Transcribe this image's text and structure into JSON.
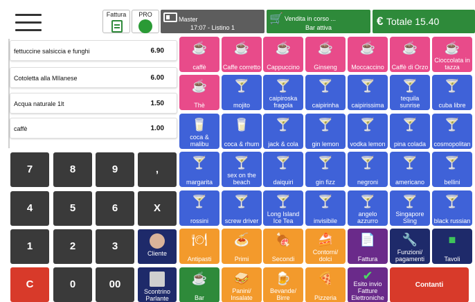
{
  "header": {
    "fattura_label": "Fattura",
    "pro_label": "PRO",
    "master_title": "Master",
    "master_sub": "17:07 - Listino 1",
    "sale_title": "Vendita in corso ...",
    "sale_sub": "Bar attiva",
    "total_label": "Totale 15.40",
    "currency_symbol": "€"
  },
  "order_items": [
    {
      "name": "fettuccine salsiccia e funghi",
      "price": "6.90"
    },
    {
      "name": "Cotoletta alla MIlanese",
      "price": "6.00"
    },
    {
      "name": "Acqua naturale 1lt",
      "price": "1.50"
    },
    {
      "name": "caffè",
      "price": "1.00"
    }
  ],
  "keypad": {
    "k7": "7",
    "k8": "8",
    "k9": "9",
    "kcomma": ",",
    "k4": "4",
    "k5": "5",
    "k6": "6",
    "kx": "X",
    "k1": "1",
    "k2": "2",
    "k3": "3",
    "cliente": "Cliente",
    "kc": "C",
    "k0": "0",
    "k00": "00",
    "scontrino": "Scontrino Parlante"
  },
  "products": {
    "r1": [
      "caffè",
      "Caffe corretto",
      "Cappuccino",
      "Ginseng",
      "Moccaccino",
      "Caffè di Orzo",
      "Cioccolata in tazza"
    ],
    "r2": [
      "Thè",
      "mojito",
      "caipiroska fragola",
      "caipirinha",
      "caipirissima",
      "tequila sunrise",
      "cuba libre"
    ],
    "r3": [
      "coca & malibu",
      "coca & rhum",
      "jack & cola",
      "gin lemon",
      "vodka lemon",
      "pina colada",
      "cosmopolitan"
    ],
    "r4": [
      "margarita",
      "sex on the beach",
      "daiquiri",
      "gin fizz",
      "negroni",
      "americano",
      "bellini"
    ],
    "r5": [
      "rossini",
      "screw driver",
      "Long Island Ice Tea",
      "invisibile",
      "angelo azzurro",
      "Singapore Sling",
      "black russian"
    ],
    "r6": [
      "Antipasti",
      "Primi",
      "Secondi",
      "Contorni/ dolci",
      "Fattura",
      "Funzioni/ pagamenti",
      "Tavoli"
    ],
    "r7": [
      "Bar",
      "Panini/ Insalate",
      "Bevande/ Birre",
      "Pizzeria",
      "Esito invio Fatture Elettroniche",
      "Contanti"
    ]
  },
  "colors": {
    "coffee": "#e84b8a",
    "drinks": "#3f62d8",
    "food": "#f39a2c",
    "green": "#2e8a3a",
    "contanti": "#d83a2a"
  }
}
